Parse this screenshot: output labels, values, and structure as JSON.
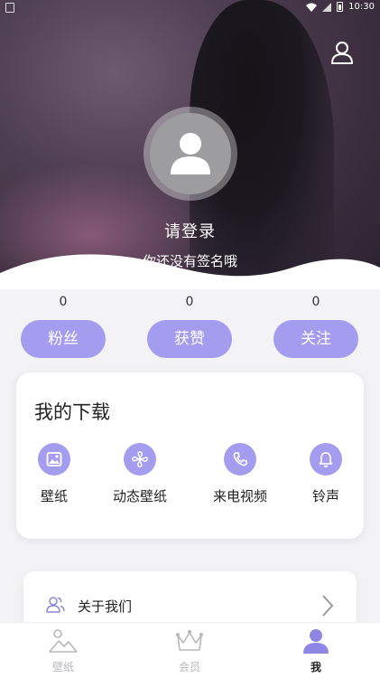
{
  "status_bar": {
    "time": "10:30"
  },
  "profile": {
    "login_text": "请登录",
    "signature_text": "你还没有签名哦"
  },
  "stats": [
    {
      "count": "0",
      "label": "粉丝"
    },
    {
      "count": "0",
      "label": "获赞"
    },
    {
      "count": "0",
      "label": "关注"
    }
  ],
  "downloads": {
    "title": "我的下载",
    "items": [
      {
        "label": "壁纸",
        "icon": "image-icon"
      },
      {
        "label": "动态壁纸",
        "icon": "fan-icon"
      },
      {
        "label": "来电视频",
        "icon": "phone-icon"
      },
      {
        "label": "铃声",
        "icon": "bell-icon"
      }
    ]
  },
  "about": {
    "label": "关于我们"
  },
  "bottom_nav": [
    {
      "label": "壁纸",
      "icon": "landscape-icon",
      "active": false
    },
    {
      "label": "会员",
      "icon": "crown-icon",
      "active": false
    },
    {
      "label": "我",
      "icon": "user-icon",
      "active": true
    }
  ],
  "colors": {
    "accent": "#a49cee",
    "background": "#f3f3f5"
  }
}
